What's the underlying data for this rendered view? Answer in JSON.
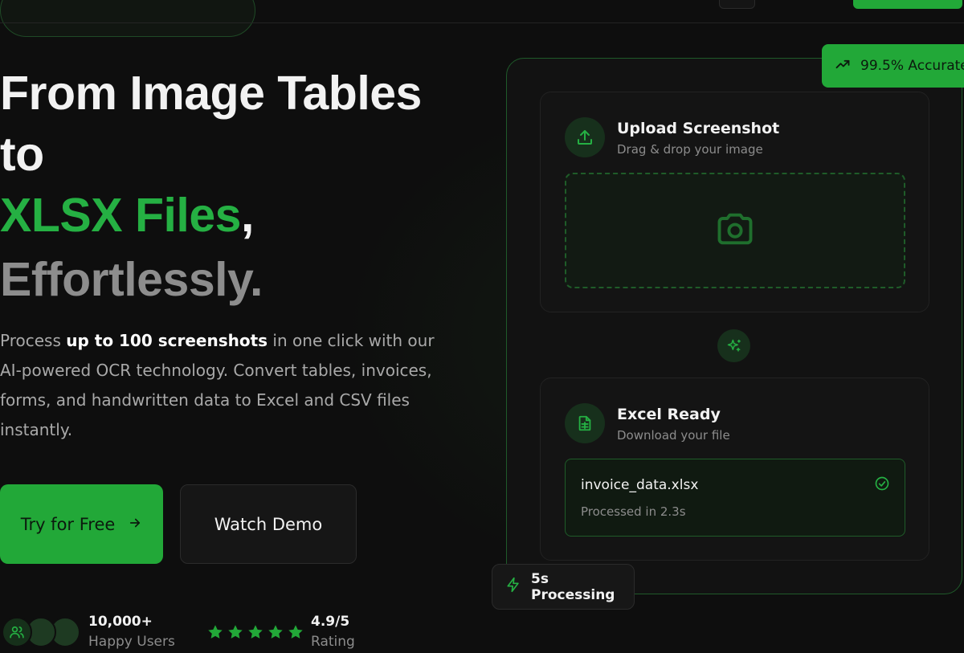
{
  "hero": {
    "title_line1": "From Image Tables",
    "title_line2": "to",
    "title_green": "XLSX Files",
    "title_comma": ",",
    "title_grey": "Effortlessly.",
    "desc_pre": "Process ",
    "desc_bold": "up to 100 screenshots",
    "desc_post": " in one click with our AI-powered OCR technology. Convert tables, invoices, forms, and handwritten data to Excel and CSV files instantly."
  },
  "buttons": {
    "primary_label": "Try for Free",
    "primary_icon": "arrow-right-icon",
    "secondary_label": "Watch Demo"
  },
  "social_proof": {
    "users_value": "10,000+",
    "users_label": "Happy Users",
    "rating_value": "4.9/5",
    "rating_label": "Rating",
    "stars": 5
  },
  "card": {
    "accuracy_badge": "99.5% Accurate",
    "upload_title": "Upload Screenshot",
    "upload_subtitle": "Drag & drop your image",
    "excel_title": "Excel Ready",
    "excel_subtitle": "Download your file",
    "file_name": "invoice_data.xlsx",
    "file_meta": "Processed in 2.3s",
    "processing_badge": "5s Processing"
  },
  "colors": {
    "accent": "#22a838",
    "background": "#0e0e0e",
    "muted_text": "#8c8c8c"
  }
}
